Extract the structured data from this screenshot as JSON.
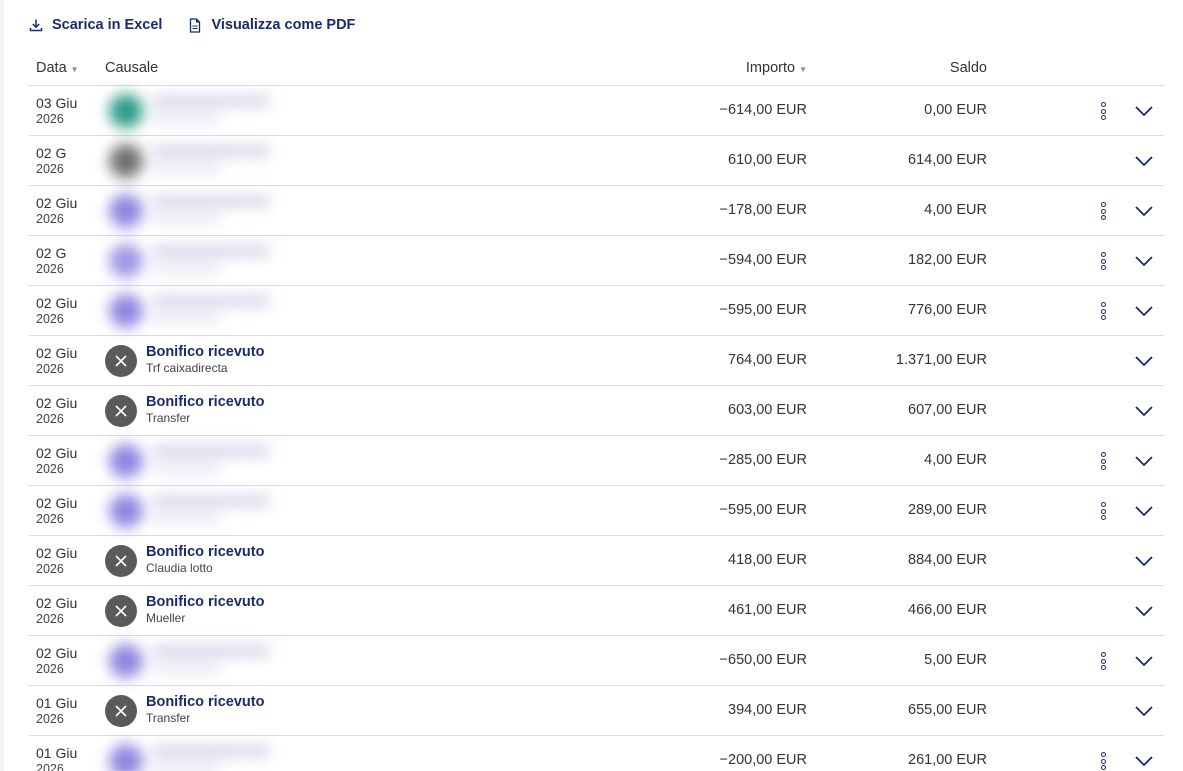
{
  "toolbar": {
    "excel_label": "Scarica in Excel",
    "pdf_label": "Visualizza come PDF"
  },
  "columns": {
    "date": "Data",
    "causale": "Causale",
    "importo": "Importo",
    "saldo": "Saldo"
  },
  "rows": [
    {
      "day": "03 Giu",
      "year": "2026",
      "title": "",
      "subtitle": "",
      "amount": "−614,00 EUR",
      "balance": "0,00 EUR",
      "blurred": true,
      "blur_color": "#2e9c8a",
      "menu": true
    },
    {
      "day": "02 G",
      "year": "2026",
      "title": "",
      "subtitle": "",
      "amount": "610,00 EUR",
      "balance": "614,00 EUR",
      "blurred": true,
      "blur_color": "#6f6f6f",
      "menu": false
    },
    {
      "day": "02 Giu",
      "year": "2026",
      "title": "",
      "subtitle": "",
      "amount": "−178,00 EUR",
      "balance": "4,00 EUR",
      "blurred": true,
      "blur_color": "#8f86e0",
      "menu": true
    },
    {
      "day": "02 G",
      "year": "2026",
      "title": "",
      "subtitle": "",
      "amount": "−594,00 EUR",
      "balance": "182,00 EUR",
      "blurred": true,
      "blur_color": "#9f97e6",
      "menu": true
    },
    {
      "day": "02 Giu",
      "year": "2026",
      "title": "",
      "subtitle": "",
      "amount": "−595,00 EUR",
      "balance": "776,00 EUR",
      "blurred": true,
      "blur_color": "#8f86e0",
      "menu": true
    },
    {
      "day": "02 Giu",
      "year": "2026",
      "title": "Bonifico ricevuto",
      "subtitle": "Trf caixadirecta",
      "amount": "764,00 EUR",
      "balance": "1.371,00 EUR",
      "blurred": false,
      "menu": false
    },
    {
      "day": "02 Giu",
      "year": "2026",
      "title": "Bonifico ricevuto",
      "subtitle": "Transfer",
      "amount": "603,00 EUR",
      "balance": "607,00 EUR",
      "blurred": false,
      "menu": false
    },
    {
      "day": "02 Giu",
      "year": "2026",
      "title": "",
      "subtitle": "",
      "amount": "−285,00 EUR",
      "balance": "4,00 EUR",
      "blurred": true,
      "blur_color": "#8f86e0",
      "menu": true
    },
    {
      "day": "02 Giu",
      "year": "2026",
      "title": "",
      "subtitle": "",
      "amount": "−595,00 EUR",
      "balance": "289,00 EUR",
      "blurred": true,
      "blur_color": "#8f86e0",
      "menu": true
    },
    {
      "day": "02 Giu",
      "year": "2026",
      "title": "Bonifico ricevuto",
      "subtitle": "Claudia lotto",
      "amount": "418,00 EUR",
      "balance": "884,00 EUR",
      "blurred": false,
      "menu": false
    },
    {
      "day": "02 Giu",
      "year": "2026",
      "title": "Bonifico ricevuto",
      "subtitle": "Mueller",
      "amount": "461,00 EUR",
      "balance": "466,00 EUR",
      "blurred": false,
      "menu": false
    },
    {
      "day": "02 Giu",
      "year": "2026",
      "title": "",
      "subtitle": "",
      "amount": "−650,00 EUR",
      "balance": "5,00 EUR",
      "blurred": true,
      "blur_color": "#8f86e0",
      "menu": true
    },
    {
      "day": "01 Giu",
      "year": "2026",
      "title": "Bonifico ricevuto",
      "subtitle": "Transfer",
      "amount": "394,00 EUR",
      "balance": "655,00 EUR",
      "blurred": false,
      "menu": false
    },
    {
      "day": "01 Giu",
      "year": "2026",
      "title": "",
      "subtitle": "",
      "amount": "−200,00 EUR",
      "balance": "261,00 EUR",
      "blurred": true,
      "blur_color": "#8f86e0",
      "menu": true
    }
  ],
  "icons": {
    "excel": "download-icon",
    "pdf": "document-pdf-icon",
    "avatar": "close-circle-icon",
    "menu": "kebab-menu-icon",
    "expand": "chevron-down-icon",
    "sort": "sort-caret-icon"
  },
  "colors": {
    "accent": "#1b2a6b",
    "divider": "#dadce3",
    "avatar_bg": "#5a5a5a",
    "sort_caret": "#8a8a8a"
  }
}
